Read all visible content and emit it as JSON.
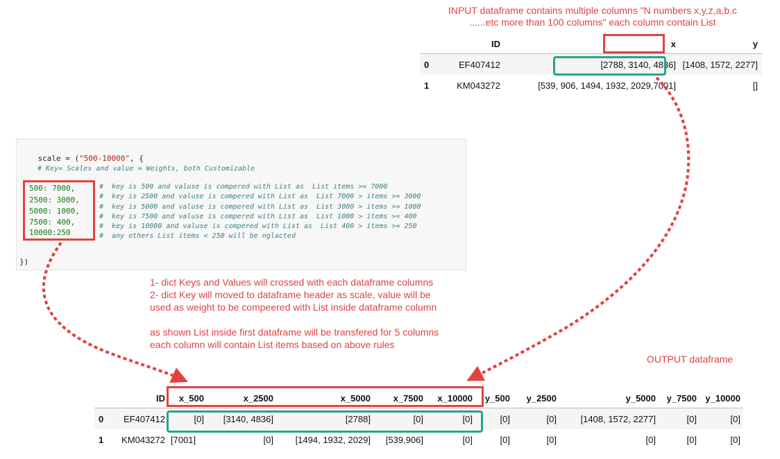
{
  "top_note": {
    "line1": "INPUT dataframe contains multiple columns \"N numbers  x,y,z,a,b,c",
    "line2": "......etc more than 100 columns\" each column contain List"
  },
  "input_table": {
    "headers": [
      "",
      "ID",
      "x",
      "y"
    ],
    "rows": [
      [
        "0",
        "EF407412",
        "[2788, 3140, 4836]",
        "[1408, 1572, 2277]"
      ],
      [
        "1",
        "KM043272",
        "[539, 906, 1494, 1932, 2029,7001]",
        "[]"
      ]
    ]
  },
  "code": {
    "line1_prefix": "scale = (",
    "line1_string": "\"500-10000\"",
    "line1_suffix": ", {",
    "comment_header": "# Key= Scales and value = Weights, both Customizable",
    "entries": [
      {
        "key": "500: 7000,",
        "comment": "#  key is 500 and valuse is compered with List as  List items >= 7000"
      },
      {
        "key": "2500: 3000,",
        "comment": "#  key is 2500 and valuse is compered with List as  List 7000 > items >= 3000"
      },
      {
        "key": "5000: 1000,",
        "comment": "#  key is 5000 and valuse is compered with List as  List 3000 > items >= 1000"
      },
      {
        "key": "7500: 400,",
        "comment": "#  key is 7500 and valuse is compered with List as  List 1000 > items >= 400"
      },
      {
        "key": "10000:250",
        "comment": "#  key is 10000 and valuse is compered with List as  List 400 > items >= 250"
      }
    ],
    "trailing_comment": "#  any others List items < 250 will be nglacted",
    "closing": "})"
  },
  "mid_note": {
    "line1": "1- dict Keys and Values will crossed with each dataframe columns",
    "line2": "2- dict Key will moved to dataframe header as scale, value will be",
    "line3": "used as weight to be compeered with List inside dataframe column",
    "line4": "as shown List inside first dataframe will be transfered for 5 columns",
    "line5": "each column will contain List items based on above rules"
  },
  "output_label": "OUTPUT  dataframe",
  "output_table": {
    "headers": [
      "",
      "ID",
      "x_500",
      "x_2500",
      "x_5000",
      "x_7500",
      "x_10000",
      "y_500",
      "y_2500",
      "y_5000",
      "y_7500",
      "y_10000"
    ],
    "rows": [
      [
        "0",
        "EF407412",
        "[0]",
        "[3140, 4836]",
        "[2788]",
        "[0]",
        "[0]",
        "[0]",
        "[0]",
        "[1408, 1572, 2277]",
        "[0]",
        "[0]"
      ],
      [
        "1",
        "KM043272",
        "[7001]",
        "[0]",
        "[1494, 1932, 2029]",
        "[539,906]",
        "[0]",
        "[0]",
        "[0]",
        "[0]",
        "[0]",
        "[0]"
      ]
    ]
  },
  "colors": {
    "annotation_red": "#e3423f",
    "highlight_teal": "#23a58b",
    "note_text": "#e0423f"
  }
}
